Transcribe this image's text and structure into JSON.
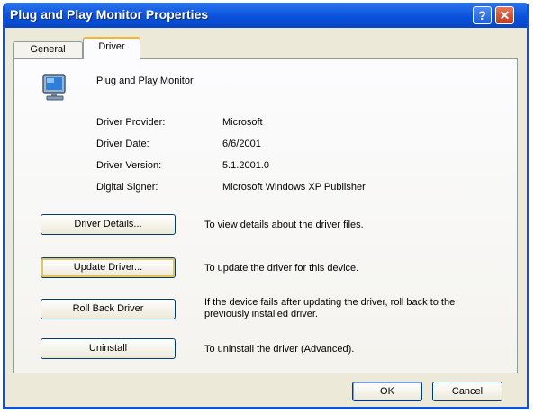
{
  "window": {
    "title": "Plug and Play Monitor Properties",
    "help_label": "?",
    "close_label": "✕"
  },
  "tabs": [
    {
      "label": "General",
      "active": false
    },
    {
      "label": "Driver",
      "active": true
    }
  ],
  "device": {
    "name": "Plug and Play Monitor",
    "icon": "monitor-icon"
  },
  "info": [
    {
      "label": "Driver Provider:",
      "value": "Microsoft"
    },
    {
      "label": "Driver Date:",
      "value": "6/6/2001"
    },
    {
      "label": "Driver Version:",
      "value": "5.1.2001.0"
    },
    {
      "label": "Digital Signer:",
      "value": "Microsoft Windows XP Publisher"
    }
  ],
  "actions": [
    {
      "label": "Driver Details...",
      "description": "To view details about the driver files."
    },
    {
      "label": "Update Driver...",
      "description": "To update the driver for this device."
    },
    {
      "label": "Roll Back Driver",
      "description": "If the device fails after updating the driver, roll back to the previously installed driver."
    },
    {
      "label": "Uninstall",
      "description": "To uninstall the driver (Advanced)."
    }
  ],
  "footer": {
    "ok_label": "OK",
    "cancel_label": "Cancel"
  }
}
